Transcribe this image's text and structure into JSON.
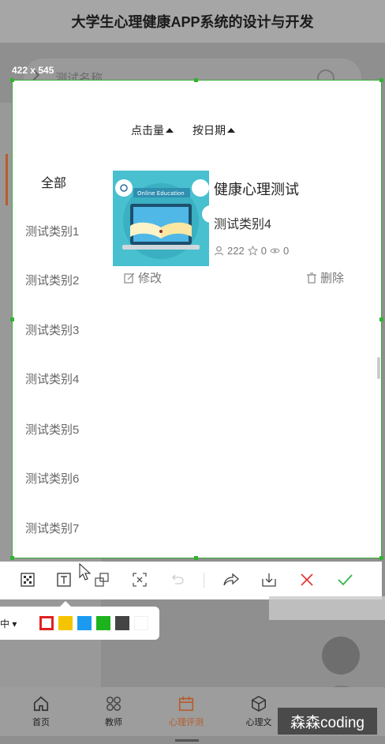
{
  "app": {
    "title": "大学生心理健康APP系统的设计与开发",
    "search_placeholder": "测试名称"
  },
  "capture": {
    "size_label": "422 x 545"
  },
  "sort": {
    "clicks_label": "点击量",
    "date_label": "按日期"
  },
  "categories": [
    {
      "label": "全部"
    },
    {
      "label": "测试类别1"
    },
    {
      "label": "测试类别2"
    },
    {
      "label": "测试类别3"
    },
    {
      "label": "测试类别4"
    },
    {
      "label": "测试类别5"
    },
    {
      "label": "测试类别6"
    },
    {
      "label": "测试类别7"
    }
  ],
  "card": {
    "thumb_caption": "Online Education",
    "title": "健康心理测试",
    "category": "测试类别4",
    "views": "222",
    "favorites": "0",
    "comments": "0",
    "edit_label": "修改",
    "delete_label": "删除"
  },
  "toolbar": {
    "size_dropdown": "中"
  },
  "colors": {
    "accent": "#b85c2b",
    "selection": "#35b035",
    "swatches": [
      "#e02020",
      "#f5c400",
      "#1a9bf0",
      "#1db31d",
      "#444444",
      "#ffffff"
    ]
  },
  "bottom_nav": [
    {
      "label": "首页"
    },
    {
      "label": "教师"
    },
    {
      "label": "心理评测"
    },
    {
      "label": "心理文"
    }
  ],
  "watermark": "森森coding"
}
